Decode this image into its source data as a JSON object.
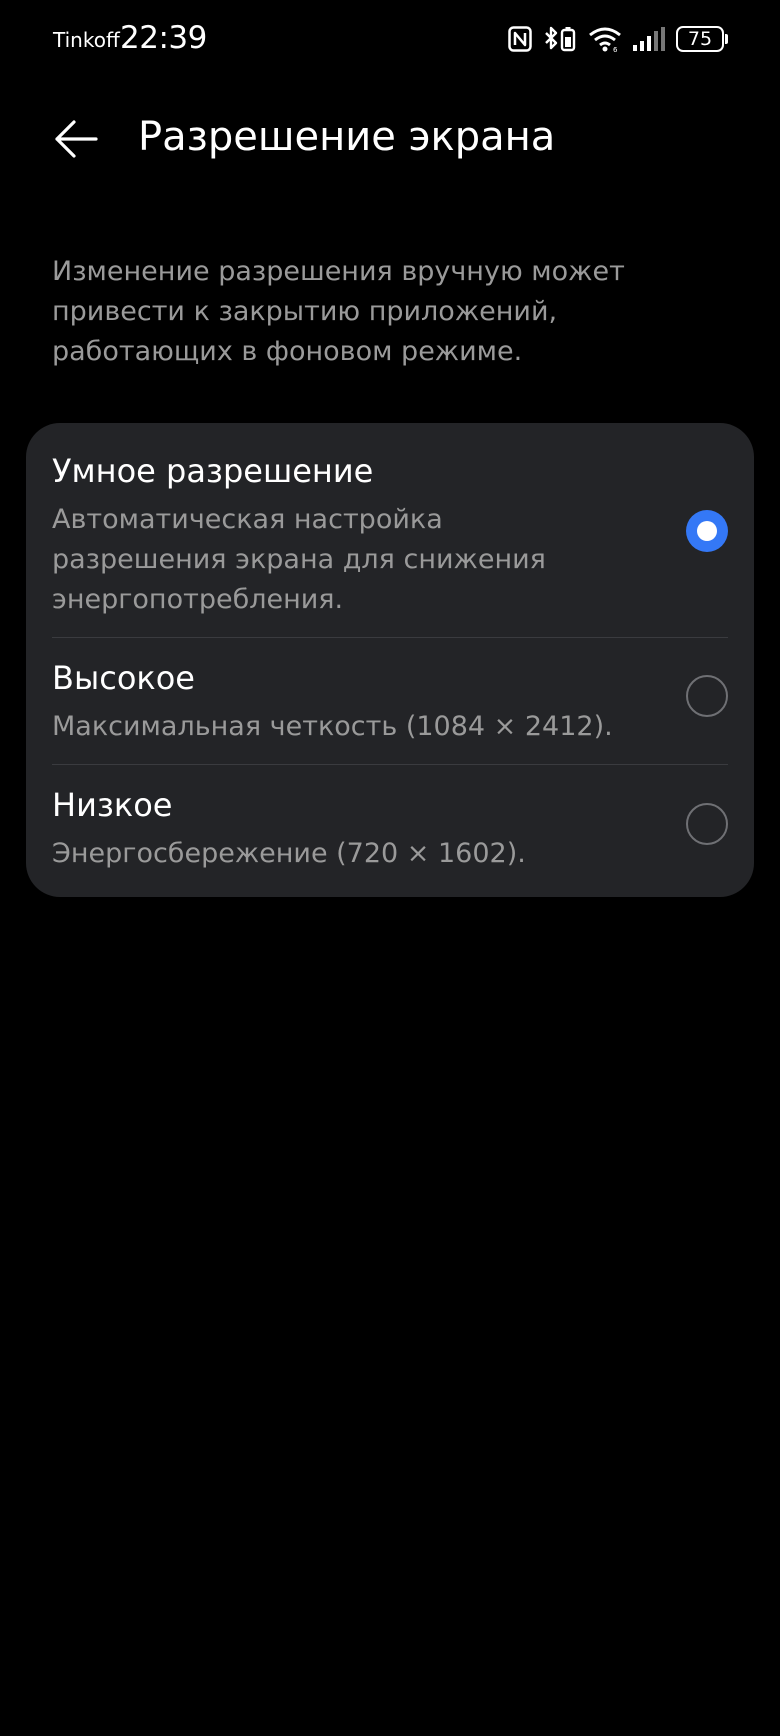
{
  "status_bar": {
    "carrier": "Tinkoff",
    "time": "22:39",
    "battery_level": "75",
    "icons": [
      "nfc-icon",
      "bluetooth-battery-icon",
      "wifi-icon",
      "cellular-signal-icon",
      "battery-icon"
    ]
  },
  "header": {
    "title": "Разрешение экрана",
    "back_icon": "back-arrow-icon"
  },
  "description": "Изменение разрешения вручную может привести к закрытию приложений, работающих в фоновом режиме.",
  "options": [
    {
      "title": "Умное разрешение",
      "subtitle": "Автоматическая настройка разрешения экрана для снижения энергопотребления.",
      "selected": true
    },
    {
      "title": "Высокое",
      "subtitle": "Максимальная четкость (1084 × 2412).",
      "selected": false
    },
    {
      "title": "Низкое",
      "subtitle": "Энергосбережение (720 × 1602).",
      "selected": false
    }
  ],
  "colors": {
    "background": "#000000",
    "card": "#232427",
    "accent": "#3478f6",
    "secondary_text": "#9a9a9a"
  }
}
